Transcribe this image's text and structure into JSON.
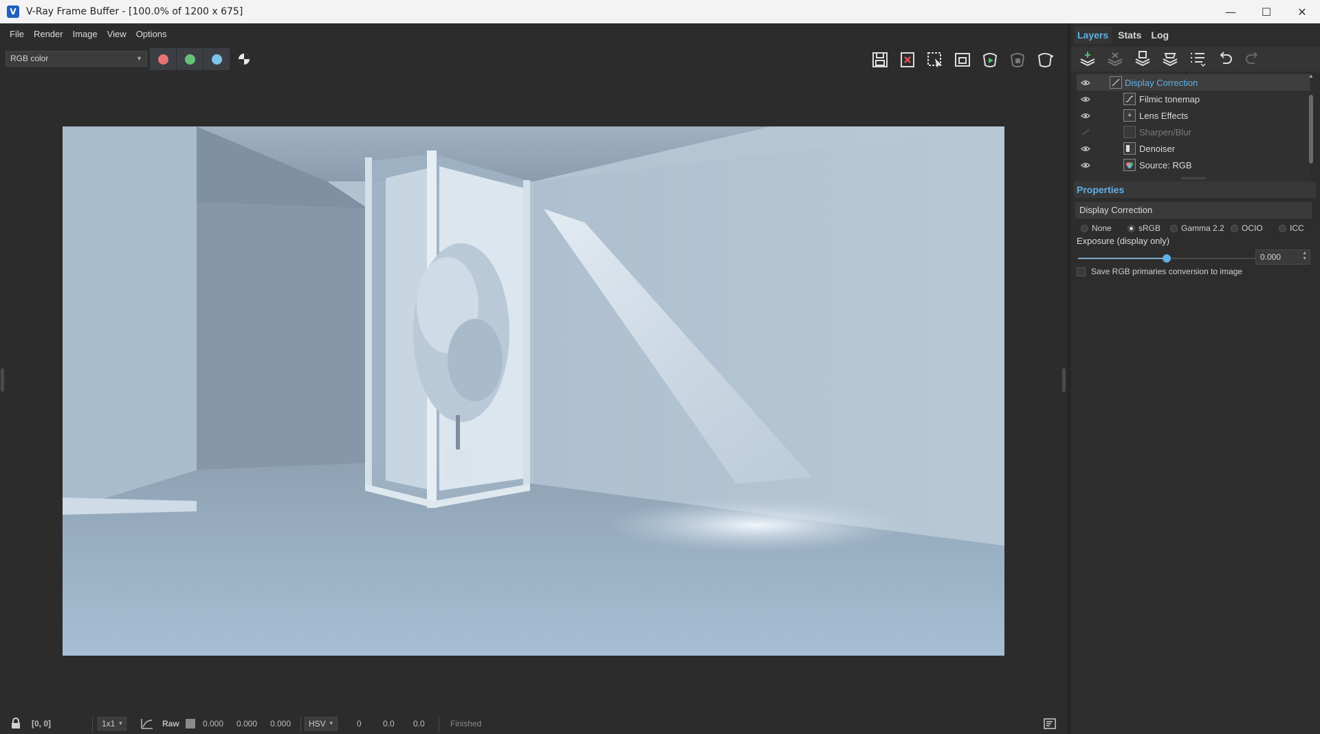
{
  "window": {
    "title": "V-Ray Frame Buffer - [100.0% of 1200 x 675]",
    "app_icon_letter": "V",
    "minimize": "—",
    "maximize": "☐",
    "close": "✕"
  },
  "menu": [
    "File",
    "Render",
    "Image",
    "View",
    "Options"
  ],
  "toolbar": {
    "channel": "RGB color",
    "channel_colors": {
      "red": "#e57373",
      "green": "#66c27a",
      "blue": "#7cc4ea"
    }
  },
  "statusbar": {
    "coords": "[0, 0]",
    "zoom": "1x1",
    "raw_label": "Raw",
    "raw_values": [
      "0.000",
      "0.000",
      "0.000"
    ],
    "color_space": "HSV",
    "hsv_values": [
      "0",
      "0.0",
      "0.0"
    ],
    "status": "Finished"
  },
  "panel": {
    "tabs": [
      "Layers",
      "Stats",
      "Log"
    ],
    "layers": [
      {
        "name": "Display Correction",
        "visible": true,
        "selected": true
      },
      {
        "name": "Filmic tonemap",
        "visible": true
      },
      {
        "name": "Lens Effects",
        "visible": true
      },
      {
        "name": "Sharpen/Blur",
        "visible": false
      },
      {
        "name": "Denoiser",
        "visible": true
      },
      {
        "name": "Source: RGB",
        "visible": true
      }
    ],
    "properties_header": "Properties",
    "properties_title": "Display Correction",
    "color_modes": [
      {
        "label": "None",
        "checked": false
      },
      {
        "label": "sRGB",
        "checked": true
      },
      {
        "label": "Gamma 2.2",
        "checked": false
      },
      {
        "label": "OCIO",
        "checked": false
      },
      {
        "label": "ICC",
        "checked": false
      }
    ],
    "exposure_label": "Exposure (display only)",
    "exposure_value": "0.000",
    "exposure_slider_fraction": 0.5,
    "save_primaries_label": "Save RGB primaries conversion to image"
  },
  "colors": {
    "accent": "#5fb0e6",
    "background": "#2c2c2c"
  }
}
